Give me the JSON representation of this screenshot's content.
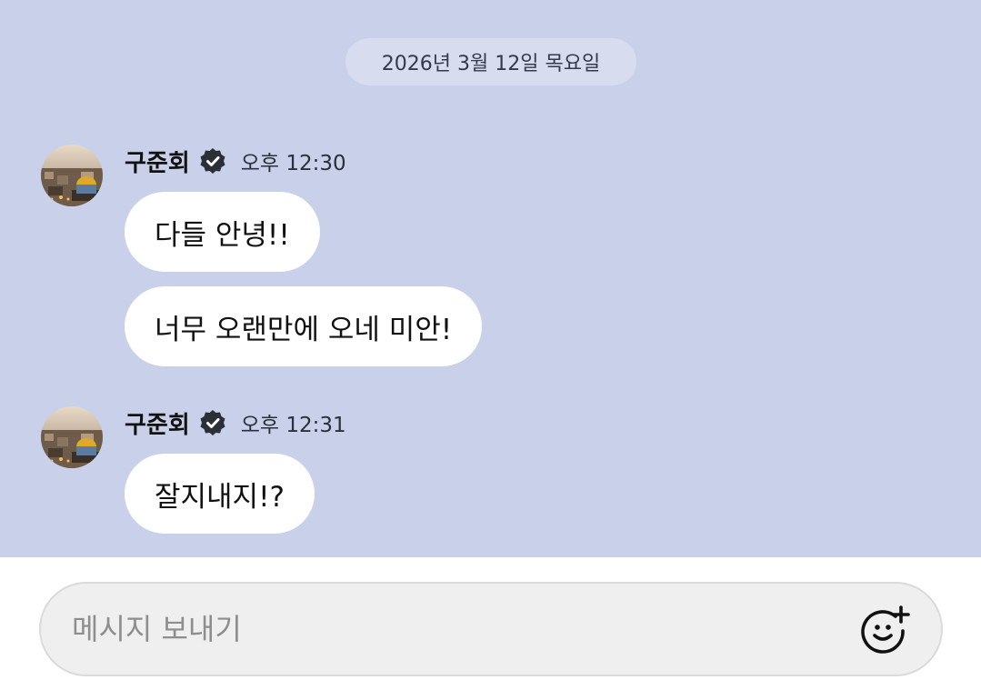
{
  "chat": {
    "date_divider": "2026년 3월 12일 목요일",
    "groups": [
      {
        "sender": "구준회",
        "time": "오후 12:30",
        "messages": [
          "다들 안녕!!",
          "너무 오랜만에 오네 미안!"
        ]
      },
      {
        "sender": "구준회",
        "time": "오후 12:31",
        "messages": [
          "잘지내지!?"
        ]
      }
    ]
  },
  "composer": {
    "placeholder": "메시지 보내기",
    "emoji_icon": "add-emoji-icon"
  },
  "colors": {
    "chat_background": "#c8d0ea",
    "bubble": "#ffffff",
    "date_pill": "#d7dcef",
    "composer_background": "#efefef"
  }
}
